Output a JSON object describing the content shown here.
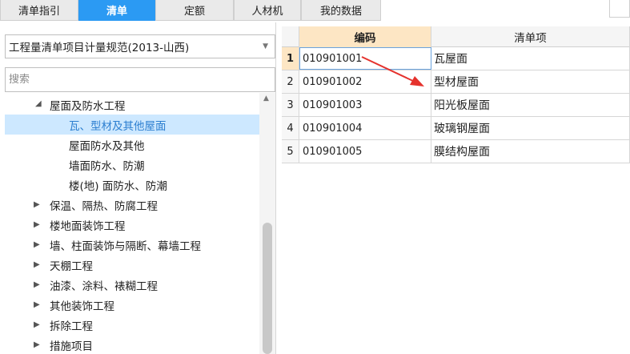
{
  "tabs": [
    {
      "label": "清单指引"
    },
    {
      "label": "清单"
    },
    {
      "label": "定额"
    },
    {
      "label": "人材机"
    },
    {
      "label": "我的数据"
    }
  ],
  "left": {
    "spec_select": {
      "value": "工程量清单项目计量规范(2013-山西)"
    },
    "search": {
      "placeholder": "搜索",
      "value": ""
    },
    "tree": [
      {
        "label": "屋面及防水工程",
        "expanded": true
      },
      {
        "label": "瓦、型材及其他屋面",
        "selected": true
      },
      {
        "label": "屋面防水及其他"
      },
      {
        "label": "墙面防水、防潮"
      },
      {
        "label": "楼(地) 面防水、防潮"
      },
      {
        "label": "保温、隔热、防腐工程"
      },
      {
        "label": "楼地面装饰工程"
      },
      {
        "label": "墙、柱面装饰与隔断、幕墙工程"
      },
      {
        "label": "天棚工程"
      },
      {
        "label": "油漆、涂料、裱糊工程"
      },
      {
        "label": "其他装饰工程"
      },
      {
        "label": "拆除工程"
      },
      {
        "label": "措施项目"
      }
    ]
  },
  "grid": {
    "headers": {
      "code": "编码",
      "name": "清单项"
    },
    "rows": [
      {
        "num": "1",
        "code": "010901001",
        "name": "瓦屋面",
        "active": true
      },
      {
        "num": "2",
        "code": "010901002",
        "name": "型材屋面"
      },
      {
        "num": "3",
        "code": "010901003",
        "name": "阳光板屋面"
      },
      {
        "num": "4",
        "code": "010901004",
        "name": "玻璃钢屋面"
      },
      {
        "num": "5",
        "code": "010901005",
        "name": "膜结构屋面"
      }
    ]
  },
  "colors": {
    "accent": "#2b9af3",
    "selection": "#cde8ff",
    "code_header": "#fde6c4",
    "annotation_arrow": "#e5322d"
  }
}
